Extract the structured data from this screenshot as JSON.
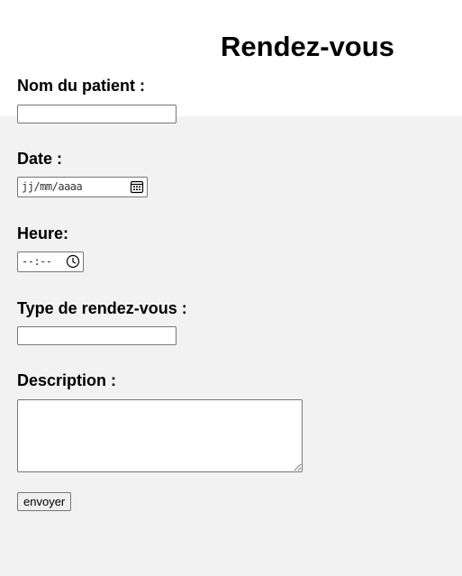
{
  "page": {
    "title": "Rendez-vous"
  },
  "form": {
    "patient_name": {
      "label": "Nom du patient :",
      "value": ""
    },
    "date": {
      "label": "Date :",
      "placeholder": "jj/mm/aaaa",
      "icon": "calendar-icon"
    },
    "time": {
      "label": "Heure:",
      "placeholder": "--:--",
      "icon": "clock-icon"
    },
    "appointment_type": {
      "label": "Type de rendez-vous :",
      "value": ""
    },
    "description": {
      "label": "Description :",
      "value": ""
    },
    "submit_label": "envoyer"
  },
  "colors": {
    "panel_background": "#f2f2f2",
    "input_border": "#767676",
    "button_background": "#efefef"
  }
}
